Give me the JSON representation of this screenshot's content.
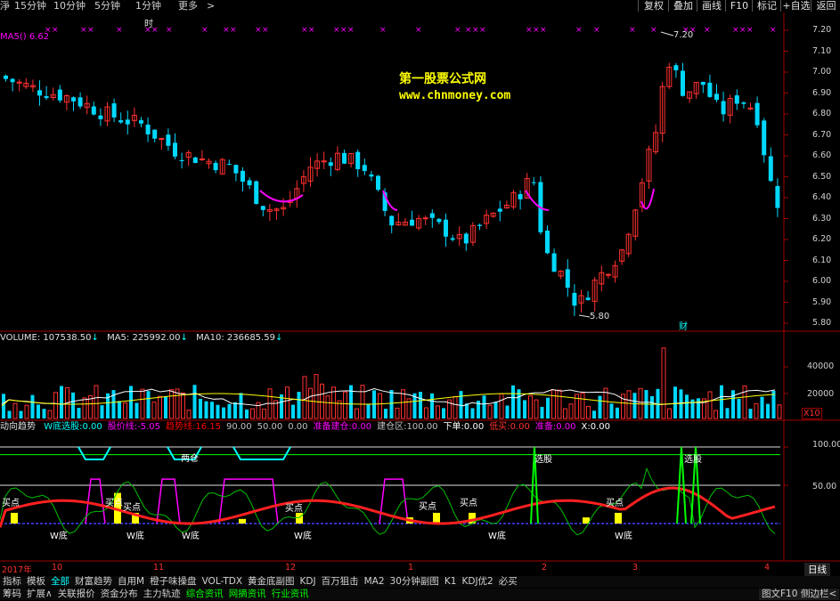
{
  "topbar": {
    "periods": [
      "淨",
      "15分钟",
      "10分钟",
      "5分钟",
      "1分钟",
      "更多",
      ">"
    ],
    "buttons": [
      "复权",
      "叠加",
      "画线",
      "F10",
      "标记",
      "+自选",
      "返回"
    ]
  },
  "main_chart": {
    "ma_label": "MA5() 6.62",
    "shi_label": "时",
    "high_label": "7.20",
    "low_label": "5.80",
    "cai_label": "财",
    "y_ticks": [
      "7.20",
      "7.10",
      "7.00",
      "6.90",
      "6.80",
      "6.70",
      "6.60",
      "6.50",
      "6.40",
      "6.30",
      "6.20",
      "6.10",
      "6.00",
      "5.90",
      "5.80"
    ],
    "watermark_title": "第一股票公式网",
    "watermark_url": "www.chnmoney.com"
  },
  "volume": {
    "label_vol": "VOLUME: 107538.50",
    "label_ma5": "MA5: 225992.00",
    "label_ma10": "MA10: 236685.59",
    "y_ticks": [
      "40000",
      "20000"
    ],
    "scale": "X10"
  },
  "indicator": {
    "name": "动向趋势",
    "items": [
      {
        "label": "W底选股:",
        "value": "0.00",
        "color": "#00ffff"
      },
      {
        "label": "股价线:",
        "value": "-5.05",
        "color": "#ff00ff"
      },
      {
        "label": "趋势线:",
        "value": "16.15",
        "color": "#ff0000"
      },
      {
        "label": "",
        "value": "90.00",
        "color": "#c0c0c0"
      },
      {
        "label": "",
        "value": "50.00",
        "color": "#c0c0c0"
      },
      {
        "label": "",
        "value": "0.00",
        "color": "#c0c0c0"
      },
      {
        "label": "准备建仓:",
        "value": "0.00",
        "color": "#ff00ff"
      },
      {
        "label": "建仓区:",
        "value": "100.00",
        "color": "#c0c0c0"
      },
      {
        "label": "下单:",
        "value": "0.00",
        "color": "#ffffff"
      },
      {
        "label": "低买:",
        "value": "0.00",
        "color": "#ff3030"
      },
      {
        "label": "准备:",
        "value": "0.00",
        "color": "#ff00ff"
      },
      {
        "label": "X:",
        "value": "0.00",
        "color": "#ffffff"
      }
    ],
    "y_ticks": [
      "100.00",
      "50.00"
    ],
    "annotations": {
      "liangcang": "两仓",
      "xuangu1": "选股",
      "xuangu2": "选股",
      "maidian": "买点",
      "wdi": "W底"
    }
  },
  "date_axis": {
    "labels": [
      "2017年",
      "10",
      "11",
      "12",
      "1",
      "2",
      "3",
      "4"
    ],
    "right": "日线"
  },
  "tabs_row1": {
    "items": [
      "指标",
      "模板",
      "全部",
      "财富趋势",
      "自用M",
      "橙子味操盘",
      "VOL-TDX",
      "黄金底副图",
      "KDJ",
      "百万狙击",
      "MA2",
      "30分钟副图",
      "K1",
      "KDJ优2",
      "必买"
    ],
    "active_index": 2
  },
  "tabs_row2": {
    "items": [
      "筹码",
      "扩展∧",
      "关联报价",
      "资金分布",
      "主力轨迹",
      "综合资讯",
      "网摘资讯",
      "行业资讯"
    ],
    "right_items": [
      "图文F10",
      "侧边栏<"
    ]
  }
}
